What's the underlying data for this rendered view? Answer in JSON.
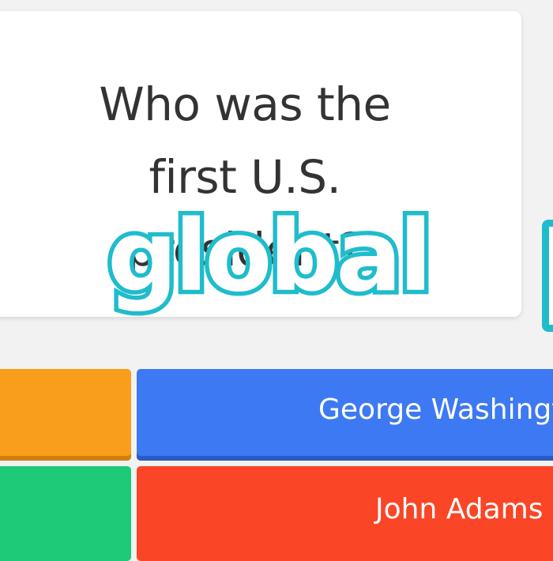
{
  "question": {
    "text": "Who was the first U.S. president?"
  },
  "overlay": {
    "word": "global"
  },
  "answers": [
    {
      "color": "#f89d1c",
      "label": ""
    },
    {
      "color": "#3d79f2",
      "label": "George Washington"
    },
    {
      "color": "#1ec977",
      "label": ""
    },
    {
      "color": "#fb4527",
      "label": "John Adams"
    }
  ]
}
